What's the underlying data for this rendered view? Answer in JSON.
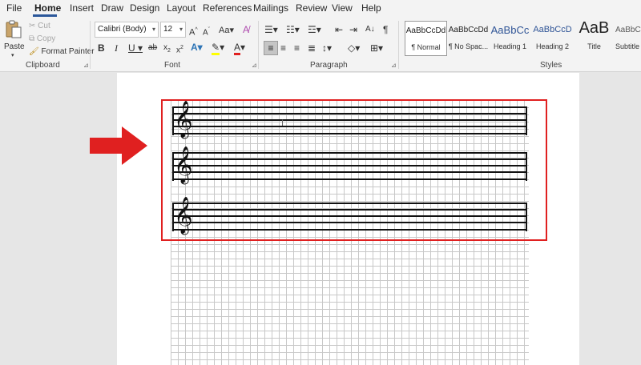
{
  "tabs": [
    "File",
    "Home",
    "Insert",
    "Draw",
    "Design",
    "Layout",
    "References",
    "Mailings",
    "Review",
    "View",
    "Help"
  ],
  "clipboard": {
    "group_label": "Clipboard",
    "paste": "Paste",
    "cut": "Cut",
    "copy": "Copy",
    "format_painter": "Format Painter"
  },
  "font": {
    "group_label": "Font",
    "name": "Calibri (Body)",
    "size": "12"
  },
  "paragraph": {
    "group_label": "Paragraph"
  },
  "styles": {
    "group_label": "Styles",
    "items": [
      {
        "preview": "AaBbCcDd",
        "name": "¶ Normal"
      },
      {
        "preview": "AaBbCcDd",
        "name": "¶ No Spac..."
      },
      {
        "preview": "AaBbCc",
        "name": "Heading 1"
      },
      {
        "preview": "AaBbCcD",
        "name": "Heading 2"
      },
      {
        "preview": "AaB",
        "name": "Title"
      },
      {
        "preview": "AaBbCcD",
        "name": "Subtitle"
      }
    ]
  },
  "colors": {
    "accent": "#2b579a",
    "highlight_box": "#e02020",
    "arrow": "#e02020"
  },
  "document": {
    "clef_glyph": "𝄞",
    "staff_count": 3
  }
}
